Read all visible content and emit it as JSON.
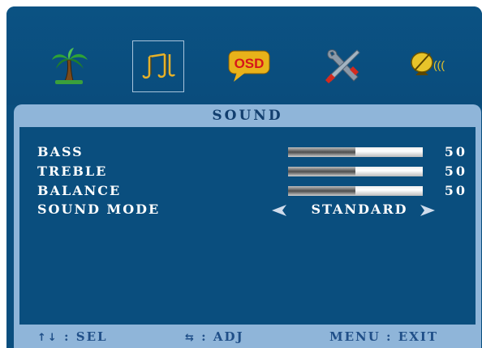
{
  "top_menu": {
    "items": [
      {
        "icon": "palm-tree-icon",
        "selected": false
      },
      {
        "icon": "music-notes-icon",
        "selected": true
      },
      {
        "icon": "osd-bubble-icon",
        "selected": false,
        "text": "OSD"
      },
      {
        "icon": "tools-icon",
        "selected": false
      },
      {
        "icon": "satellite-dish-icon",
        "selected": false,
        "text": "((("
      }
    ]
  },
  "panel": {
    "title": "SOUND",
    "items": [
      {
        "label": "BASS",
        "value": "50",
        "level": 0.5
      },
      {
        "label": "TREBLE",
        "value": "50",
        "level": 0.5
      },
      {
        "label": "BALANCE",
        "value": "50",
        "level": 0.5
      },
      {
        "label": "SOUND MODE",
        "value": "STANDARD"
      }
    ]
  },
  "footer": {
    "select_symbol": "↑↓",
    "select_text": ": SEL",
    "adjust_symbol": "⇆",
    "adjust_text": ": ADJ",
    "exit_text": "MENU : EXIT"
  },
  "colors": {
    "background": "#0a4e7e",
    "panel_border": "#8fb5d9",
    "title_text": "#123e6e",
    "footer_text": "#204f88"
  }
}
